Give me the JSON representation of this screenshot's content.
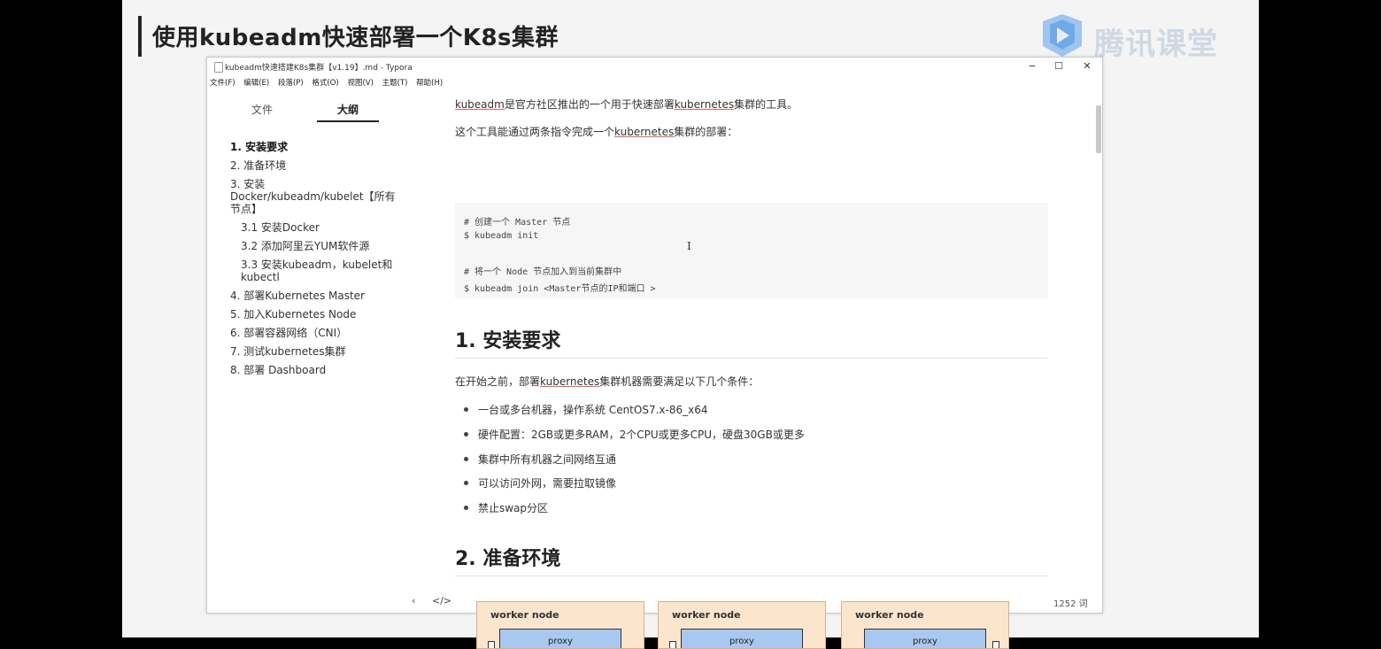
{
  "slide": {
    "title": "使用kubeadm快速部署一个K8s集群",
    "brand": "腾讯课堂"
  },
  "window": {
    "title": "kubeadm快速搭建K8s集群【v1.19】.md - Typora",
    "controls": {
      "minimize": "−",
      "maximize": "☐",
      "close": "✕"
    },
    "menu": [
      "文件(F)",
      "编辑(E)",
      "段落(P)",
      "格式(O)",
      "视图(V)",
      "主题(T)",
      "帮助(H)"
    ]
  },
  "sidebar": {
    "tabs": {
      "files": "文件",
      "outline": "大纲"
    },
    "outline": [
      "1. 安装要求",
      "2. 准备环境",
      "3. 安装 Docker/kubeadm/kubelet【所有节点】",
      "3.1 安装Docker",
      "3.2 添加阿里云YUM软件源",
      "3.3 安装kubeadm，kubelet和kubectl",
      "4. 部署Kubernetes Master",
      "5. 加入Kubernetes Node",
      "6. 部署容器网络（CNI）",
      "7. 测试kubernetes集群",
      "8. 部署 Dashboard"
    ]
  },
  "content": {
    "intro1_a": "kubeadm",
    "intro1_b": "是官方社区推出的一个用于快速部署",
    "intro1_c": "kubernetes",
    "intro1_d": "集群的工具。",
    "intro2_a": "这个工具能通过两条指令完成一个",
    "intro2_b": "kubernetes",
    "intro2_c": "集群的部署：",
    "code": [
      "# 创建一个 Master 节点",
      "$ kubeadm init",
      "# 将一个 Node 节点加入到当前集群中",
      "$ kubeadm join <Master节点的IP和端口 >"
    ],
    "h1": "1. 安装要求",
    "req_a": "在开始之前，部署",
    "req_b": "kubernetes",
    "req_c": "集群机器需要满足以下几个条件：",
    "bullets": [
      "一台或多台机器，操作系统 CentOS7.x-86_x64",
      "硬件配置：2GB或更多RAM，2个CPU或更多CPU，硬盘30GB或更多",
      "集群中所有机器之间网络互通",
      "可以访问外网，需要拉取镜像",
      "禁止swap分区"
    ],
    "h2": "2. 准备环境",
    "diagram": {
      "node_label": "worker node",
      "proxy_label": "proxy"
    }
  },
  "statusbar": {
    "back": "‹",
    "source": "</>",
    "word_count": "1252 词"
  }
}
